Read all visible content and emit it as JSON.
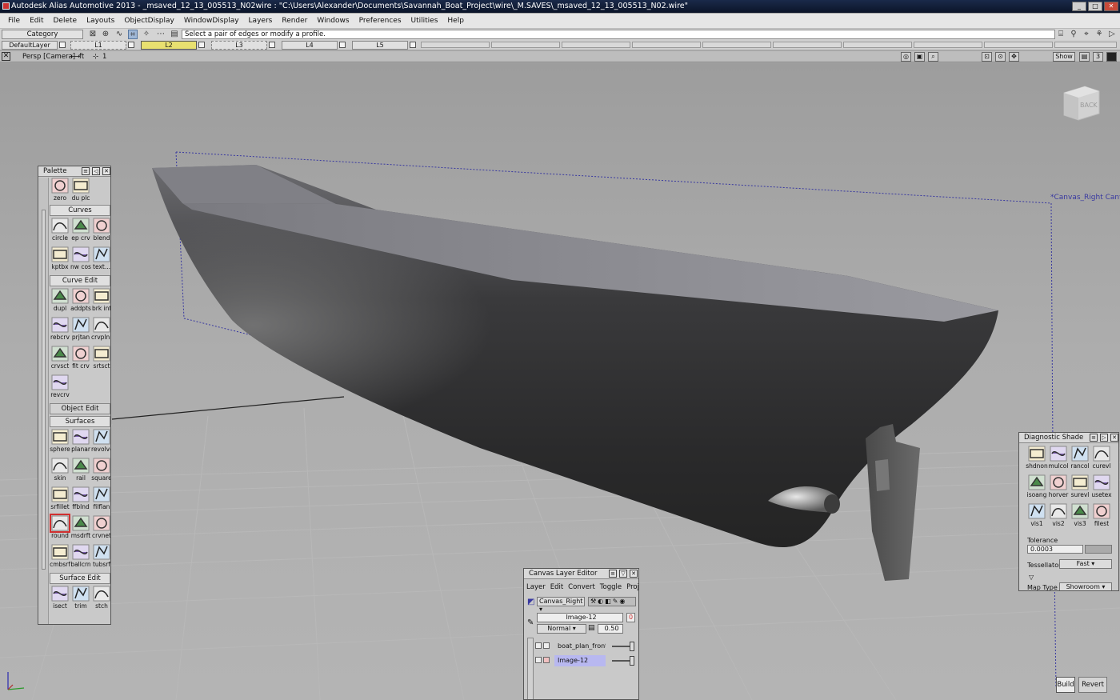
{
  "window": {
    "title": "Autodesk Alias Automotive 2013 - _msaved_12_13_005513_N02wire : \"C:\\Users\\Alexander\\Documents\\Savannah_Boat_Project\\wire\\_M.SAVES\\_msaved_12_13_005513_N02.wire\""
  },
  "menubar": [
    "File",
    "Edit",
    "Delete",
    "Layouts",
    "ObjectDisplay",
    "WindowDisplay",
    "Layers",
    "Render",
    "Windows",
    "Preferences",
    "Utilities",
    "Help"
  ],
  "toolbar": {
    "category": "Category",
    "prompt": "Select a pair of edges or modify a profile."
  },
  "layers": {
    "default": "DefaultLayer",
    "items": [
      "L1",
      "L2",
      "L3",
      "L4",
      "L5"
    ],
    "active": "L2"
  },
  "viewport": {
    "camera": "Persp [Camera]",
    "units": "ft",
    "grid_step": "1",
    "show_label": "Show",
    "count_label": "3",
    "canvas_label": "*Canvas_Right",
    "canvas_label_overlap": "Canvas_Righ",
    "viewcube_face": "BACK"
  },
  "palette": {
    "title": "Palette",
    "top_tools": [
      {
        "label": "zero",
        "icon": "zero-icon"
      },
      {
        "label": "du plc",
        "icon": "duplicate-place-icon"
      }
    ],
    "sections": [
      {
        "name": "Curves",
        "tools": [
          "circle",
          "ep crv",
          "blend",
          "kptbx",
          "nw cos",
          "text..."
        ]
      },
      {
        "name": "Curve Edit",
        "tools": [
          "dupl",
          "addpts",
          "brk inf",
          "rebcrv",
          "prjtan",
          "crvplnr",
          "crvsct",
          "fit crv",
          "srtsct",
          "revcrv"
        ]
      },
      {
        "name": "Object Edit",
        "tools": []
      },
      {
        "name": "Surfaces",
        "tools": [
          "sphere",
          "planar",
          "revolve",
          "skin",
          "rail",
          "square",
          "srfillet",
          "ffblnd",
          "filflan",
          "round",
          "msdrft",
          "crvnet",
          "cmbsrf",
          "ballcrn",
          "tubsrf"
        ]
      },
      {
        "name": "Surface Edit",
        "tools": [
          "isect",
          "trim",
          "stch"
        ]
      }
    ],
    "selected_tool": "round"
  },
  "diagnostic_shade": {
    "title": "Diagnostic Shade",
    "tools": [
      "shdnon",
      "mulcol",
      "rancol",
      "curevl",
      "isoang",
      "horver",
      "surevl",
      "usetex",
      "vis1",
      "vis2",
      "vis3",
      "filest"
    ],
    "tolerance_label": "Tolerance",
    "tolerance_value": "0.0003",
    "tessellator_label": "Tessellator",
    "tessellator_value": "Fast",
    "map_type_label": "Map Type",
    "map_type_value": "Showroom"
  },
  "canvas_layer_editor": {
    "title": "Canvas Layer Editor",
    "menu": [
      "Layer",
      "Edit",
      "Convert",
      "Toggle",
      "Project"
    ],
    "canvas": "Canvas_Right",
    "image_name": "Image-12",
    "image_badge": "0",
    "blend_mode": "Normal",
    "opacity": "0.50",
    "layers": [
      {
        "name": "boat_plan_front_",
        "selected": false
      },
      {
        "name": "Image-12",
        "selected": true
      }
    ]
  },
  "actions": {
    "build": "Build",
    "revert": "Revert"
  },
  "colors": {
    "active_layer": "#e8e070",
    "selection_highlight": "#b8b8f0",
    "canvas_guide": "#3838a0",
    "selected_tool_outline": "#d03030"
  }
}
